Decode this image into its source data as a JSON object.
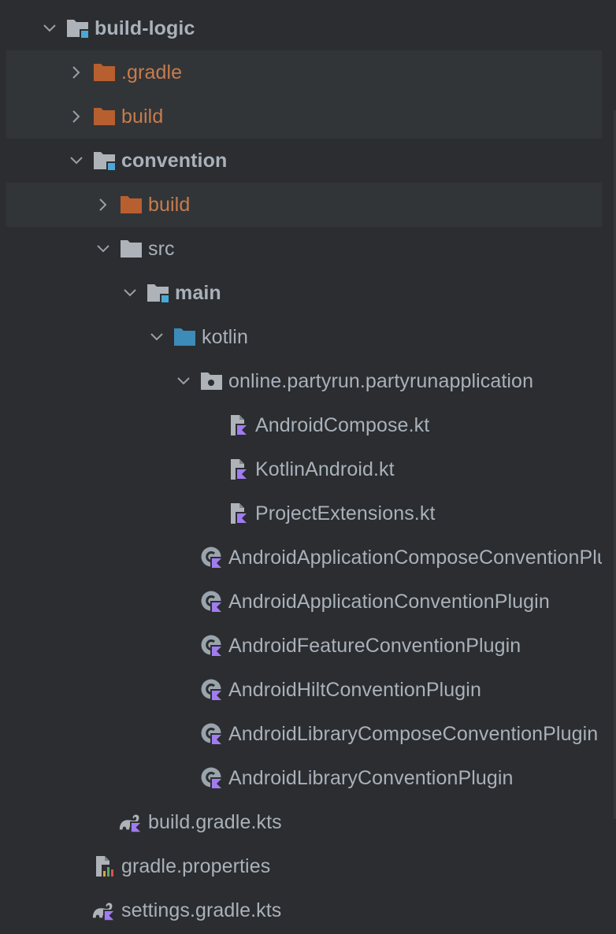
{
  "tree": {
    "items": [
      {
        "label": "build-logic",
        "icon": "module-folder-icon",
        "chevron": "expanded",
        "bold": true
      },
      {
        "label": ".gradle",
        "icon": "excluded-folder-icon",
        "chevron": "collapsed"
      },
      {
        "label": "build",
        "icon": "excluded-folder-icon",
        "chevron": "collapsed"
      },
      {
        "label": "convention",
        "icon": "module-folder-icon",
        "chevron": "expanded",
        "bold": true
      },
      {
        "label": "build",
        "icon": "excluded-folder-icon",
        "chevron": "collapsed"
      },
      {
        "label": "src",
        "icon": "folder-icon",
        "chevron": "expanded"
      },
      {
        "label": "main",
        "icon": "module-folder-icon",
        "chevron": "expanded",
        "bold": true
      },
      {
        "label": "kotlin",
        "icon": "source-folder-icon",
        "chevron": "expanded"
      },
      {
        "label": "online.partyrun.partyrunapplication",
        "icon": "package-icon",
        "chevron": "expanded"
      },
      {
        "label": "AndroidCompose.kt",
        "icon": "kotlin-file-icon"
      },
      {
        "label": "KotlinAndroid.kt",
        "icon": "kotlin-file-icon"
      },
      {
        "label": "ProjectExtensions.kt",
        "icon": "kotlin-file-icon"
      },
      {
        "label": "AndroidApplicationComposeConventionPlugin",
        "icon": "kotlin-class-icon"
      },
      {
        "label": "AndroidApplicationConventionPlugin",
        "icon": "kotlin-class-icon"
      },
      {
        "label": "AndroidFeatureConventionPlugin",
        "icon": "kotlin-class-icon"
      },
      {
        "label": "AndroidHiltConventionPlugin",
        "icon": "kotlin-class-icon"
      },
      {
        "label": "AndroidLibraryComposeConventionPlugin",
        "icon": "kotlin-class-icon"
      },
      {
        "label": "AndroidLibraryConventionPlugin",
        "icon": "kotlin-class-icon"
      },
      {
        "label": "build.gradle.kts",
        "icon": "gradle-kts-icon"
      },
      {
        "label": "gradle.properties",
        "icon": "properties-file-icon"
      },
      {
        "label": "settings.gradle.kts",
        "icon": "gradle-kts-icon"
      }
    ]
  },
  "colors": {
    "background": "#2b2d30",
    "excluded_row": "#323538",
    "text": "#a9b1ba",
    "excluded_text": "#c77c4d",
    "folder_gray": "#aeb3b9",
    "folder_orange": "#b85f30",
    "source_blue": "#3d8bb8",
    "kotlin_purple": "#a07cf0"
  }
}
